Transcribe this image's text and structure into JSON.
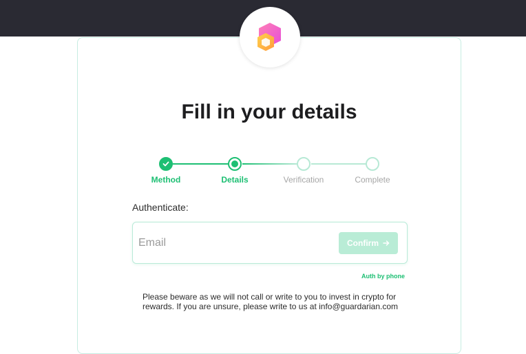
{
  "colors": {
    "topbar": "#2a2a33",
    "accent": "#1dbf73",
    "accent_light": "#b7e9d5",
    "confirm_disabled": "#b9ecd6",
    "card_border": "#c6ece1"
  },
  "logo": {
    "icon": "hex-logo-icon"
  },
  "form": {
    "title": "Fill in your details",
    "steps": [
      {
        "label": "Method",
        "state": "done"
      },
      {
        "label": "Details",
        "state": "active"
      },
      {
        "label": "Verification",
        "state": "future"
      },
      {
        "label": "Complete",
        "state": "future"
      }
    ],
    "auth_label": "Authenticate:",
    "email_placeholder": "Email",
    "email_value": "",
    "confirm_label": "Confirm",
    "confirm_icon": "arrow-right-icon",
    "auth_by_phone": "Auth by phone",
    "warning": "Please beware as we will not call or write to you to invest in crypto for rewards. If you are unsure, please write to us at info@guardarian.com"
  }
}
